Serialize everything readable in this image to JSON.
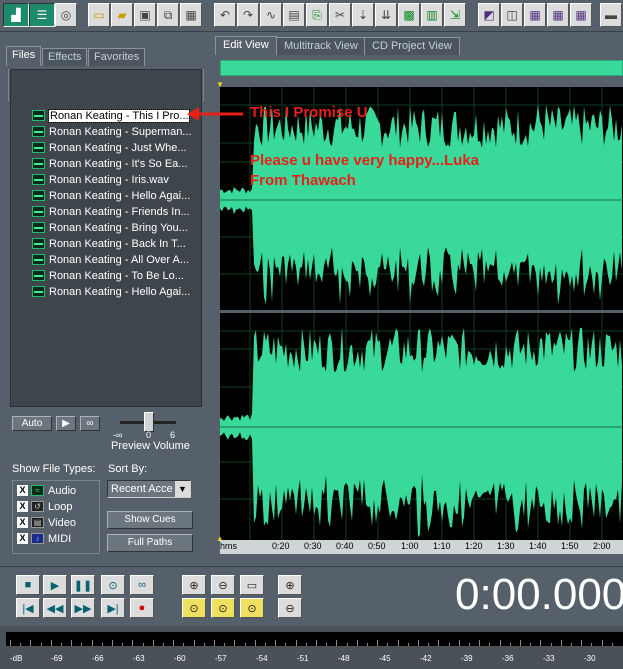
{
  "tabs": {
    "files": "Files",
    "effects": "Effects",
    "favorites": "Favorites"
  },
  "editor_tabs": {
    "edit": "Edit View",
    "multitrack": "Multitrack View",
    "cd": "CD Project View"
  },
  "files": [
    "Ronan Keating - This I Pro...",
    "Ronan Keating - Superman...",
    "Ronan Keating - Just Whe...",
    "Ronan Keating - It's So Ea...",
    "Ronan Keating - Iris.wav",
    "Ronan Keating - Hello Agai...",
    "Ronan Keating - Friends In...",
    "Ronan Keating - Bring You...",
    "Ronan Keating - Back In T...",
    "Ronan Keating - All Over A...",
    "Ronan Keating - To Be Lo...",
    "Ronan Keating - Hello Agai..."
  ],
  "preview": {
    "auto": "Auto",
    "label": "Preview Volume",
    "ticks": [
      "-∞",
      "0",
      "6"
    ]
  },
  "show_types": {
    "label": "Show File Types:",
    "audio": "Audio",
    "loop": "Loop",
    "video": "Video",
    "midi": "MIDI"
  },
  "sort_by": {
    "label": "Sort By:",
    "value": "Recent Acce"
  },
  "buttons": {
    "show_cues": "Show Cues",
    "full_paths": "Full Paths"
  },
  "ruler": [
    "hms",
    "0:20",
    "0:30",
    "0:40",
    "0:50",
    "1:00",
    "1:10",
    "1:20",
    "1:30",
    "1:40",
    "1:50",
    "2:00"
  ],
  "time_display": "0:00.000",
  "meter_scale": [
    "-dB",
    "-69",
    "-66",
    "-63",
    "-60",
    "-57",
    "-54",
    "-51",
    "-48",
    "-45",
    "-42",
    "-39",
    "-36",
    "-33",
    "-30"
  ],
  "annotations": {
    "title": "This I Promise U",
    "line1": "Please u have very happy...Luka",
    "line2": "From Thawach"
  },
  "colors": {
    "waveform": "#39d99a",
    "background": "#56606a",
    "annotation": "#e8201a"
  }
}
